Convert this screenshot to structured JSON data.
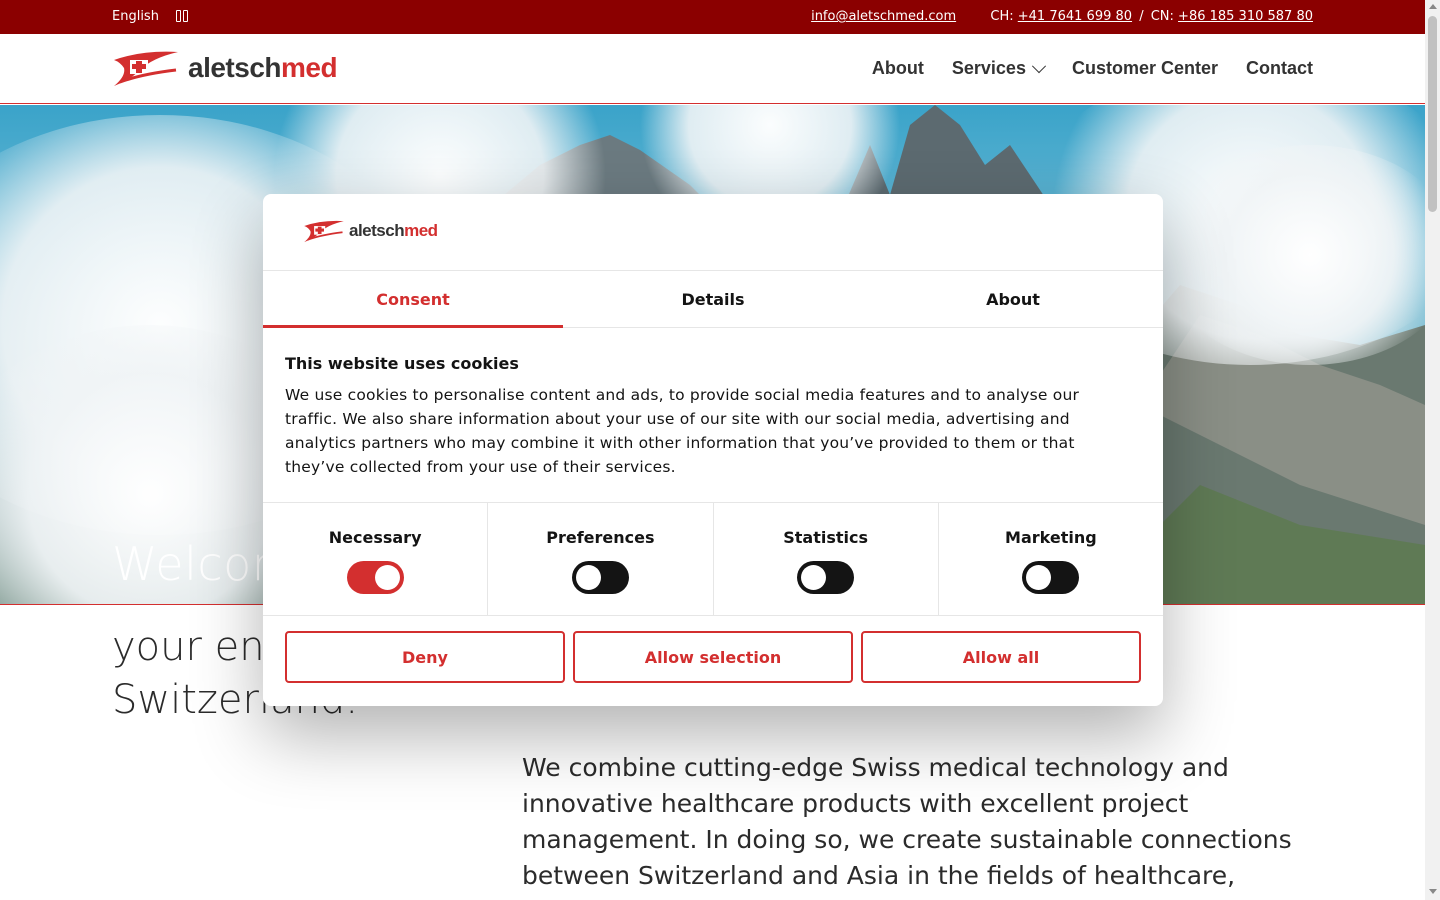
{
  "topbar": {
    "language": "English",
    "language_toggle_icon": "language-toggle-icon",
    "email": "info@aletschmed.com",
    "ch_label": "CH:",
    "ch_phone": "+41 7641 699 80",
    "separator": "/",
    "cn_label": "CN:",
    "cn_phone": "+86 185 310 587 80"
  },
  "header": {
    "logo_text_dark": "aletsch",
    "logo_text_red": "med",
    "nav": {
      "about": "About",
      "services": "Services",
      "customer_center": "Customer Center",
      "contact": "Contact"
    }
  },
  "hero": {
    "welcome": "Welcom",
    "line2": "your ent",
    "line3": "Switzerland."
  },
  "intro": {
    "paragraph": "We combine cutting-edge Swiss medical technology and innovative healthcare products with excellent project management. In doing so, we create sustainable connections between Switzerland and Asia in the fields of healthcare,"
  },
  "cookie_dialog": {
    "logo_text_dark": "aletsch",
    "logo_text_red": "med",
    "tabs": [
      "Consent",
      "Details",
      "About"
    ],
    "active_tab": "Consent",
    "title": "This website uses cookies",
    "body": "We use cookies to personalise content and ads, to provide social media features and to analyse our traffic. We also share information about your use of our site with our social media, advertising and analytics partners who may combine it with other information that you’ve provided to them or that they’ve collected from your use of their services.",
    "categories": [
      {
        "label": "Necessary",
        "enabled": true
      },
      {
        "label": "Preferences",
        "enabled": false
      },
      {
        "label": "Statistics",
        "enabled": false
      },
      {
        "label": "Marketing",
        "enabled": false
      }
    ],
    "buttons": {
      "deny": "Deny",
      "allow_selection": "Allow selection",
      "allow_all": "Allow all"
    }
  },
  "colors": {
    "brand_red": "#d32f2f",
    "topbar": "#8b0000",
    "text_dark": "#141414"
  }
}
